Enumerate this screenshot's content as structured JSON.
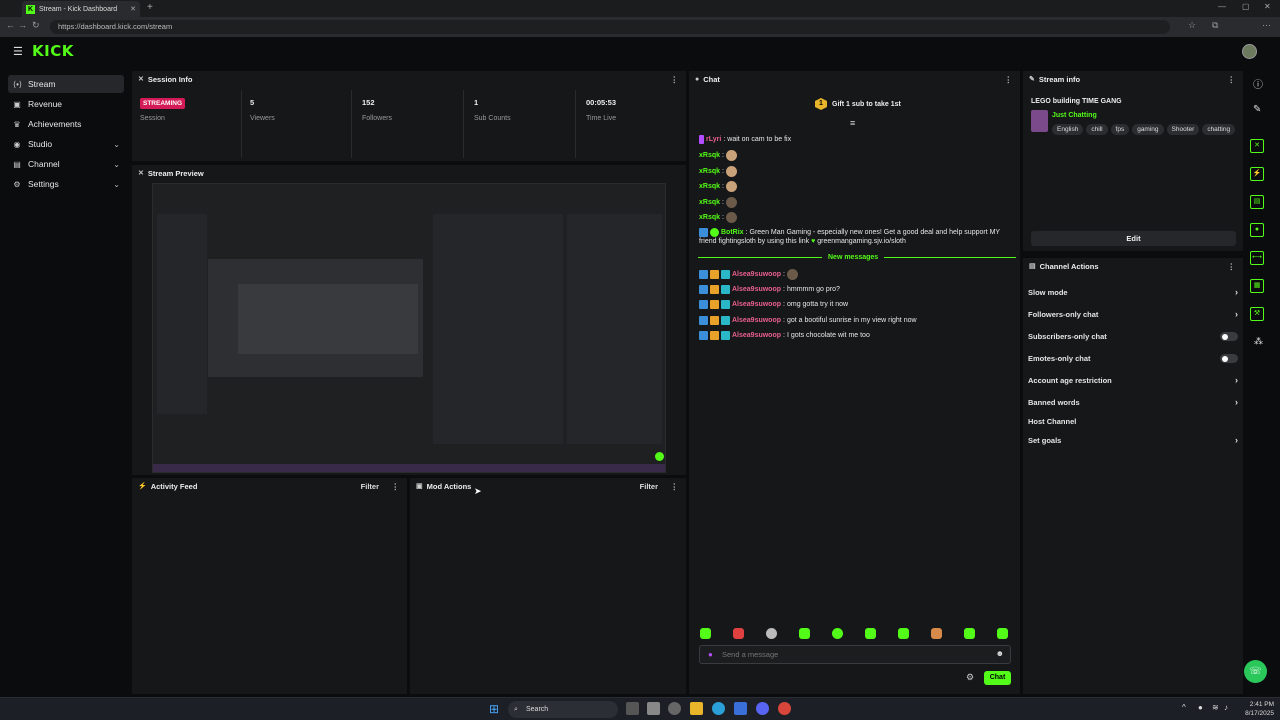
{
  "browser": {
    "tab_title": "Stream - Kick Dashboard",
    "url": "https://dashboard.kick.com/stream"
  },
  "app": {
    "logo": "KICK"
  },
  "sidebar": {
    "items": [
      {
        "label": "Stream",
        "icon": "stream-icon",
        "active": true
      },
      {
        "label": "Revenue",
        "icon": "revenue-icon"
      },
      {
        "label": "Achievements",
        "icon": "trophy-icon"
      },
      {
        "label": "Studio",
        "icon": "studio-icon",
        "expandable": true
      },
      {
        "label": "Channel",
        "icon": "channel-icon",
        "expandable": true
      },
      {
        "label": "Settings",
        "icon": "gear-icon",
        "expandable": true
      }
    ]
  },
  "session_info": {
    "title": "Session Info",
    "badge": "STREAMING",
    "session_label": "Session",
    "stats": [
      {
        "value": "5",
        "label": "Viewers"
      },
      {
        "value": "152",
        "label": "Followers"
      },
      {
        "value": "1",
        "label": "Sub Counts"
      },
      {
        "value": "00:05:53",
        "label": "Time Live"
      }
    ]
  },
  "stream_preview": {
    "title": "Stream Preview"
  },
  "activity_feed": {
    "title": "Activity Feed",
    "filter": "Filter"
  },
  "mod_actions": {
    "title": "Mod Actions",
    "filter": "Filter"
  },
  "chat": {
    "title": "Chat",
    "gift_prompt": "Gift 1 sub to take 1st",
    "gift_count": "1",
    "messages": [
      {
        "user": "rLyri",
        "text": "wait on cam to be fix",
        "color": "pink"
      },
      {
        "user": "xRsqk",
        "text": "",
        "color": "green"
      },
      {
        "user": "xRsqk",
        "text": "",
        "color": "green"
      },
      {
        "user": "xRsqk",
        "text": "",
        "color": "green"
      },
      {
        "user": "xRsqk",
        "text": "",
        "color": "green"
      },
      {
        "user": "xRsqk",
        "text": "",
        "color": "green"
      },
      {
        "user": "BotRix",
        "text": "Green Man Gaming - especially new ones! Get a good deal and help support MY",
        "color": "green"
      }
    ],
    "botrix_line2": "friend fightingsloth by using this link",
    "botrix_link": "greenmangaming.sjv.io/sloth",
    "new_messages_label": "New messages",
    "new_messages": [
      {
        "user": "Alsea9suwoop",
        "text": ""
      },
      {
        "user": "Alsea9suwoop",
        "text": "hmmmm go pro?"
      },
      {
        "user": "Alsea9suwoop",
        "text": "omg gotta try it now"
      },
      {
        "user": "Alsea9suwoop",
        "text": "got a bootiful sunrise in my view right now"
      },
      {
        "user": "Alsea9suwoop",
        "text": "I gots chocolate wit me too"
      }
    ],
    "input_placeholder": "Send a message",
    "send_button": "Chat"
  },
  "stream_info": {
    "title": "Stream info",
    "stream_title": "LEGO building TIME GANG",
    "category": "Just Chatting",
    "tags": [
      "English",
      "chill",
      "fps",
      "gaming",
      "Shooter",
      "chatting"
    ],
    "edit_button": "Edit"
  },
  "channel_actions": {
    "title": "Channel Actions",
    "items": [
      {
        "label": "Slow mode",
        "control": "chevron"
      },
      {
        "label": "Followers-only chat",
        "control": "chevron"
      },
      {
        "label": "Subscribers-only chat",
        "control": "toggle"
      },
      {
        "label": "Emotes-only chat",
        "control": "toggle"
      },
      {
        "label": "Account age restriction",
        "control": "chevron"
      },
      {
        "label": "Banned words",
        "control": "chevron"
      },
      {
        "label": "Host Channel",
        "control": "none"
      },
      {
        "label": "Set goals",
        "control": "chevron"
      }
    ]
  },
  "taskbar": {
    "search": "Search",
    "time": "2:41 PM",
    "date": "8/17/2025"
  },
  "colors": {
    "accent": "#53fc18",
    "live": "#d41b57",
    "panel": "#161718",
    "bg": "#0b0c0d"
  }
}
